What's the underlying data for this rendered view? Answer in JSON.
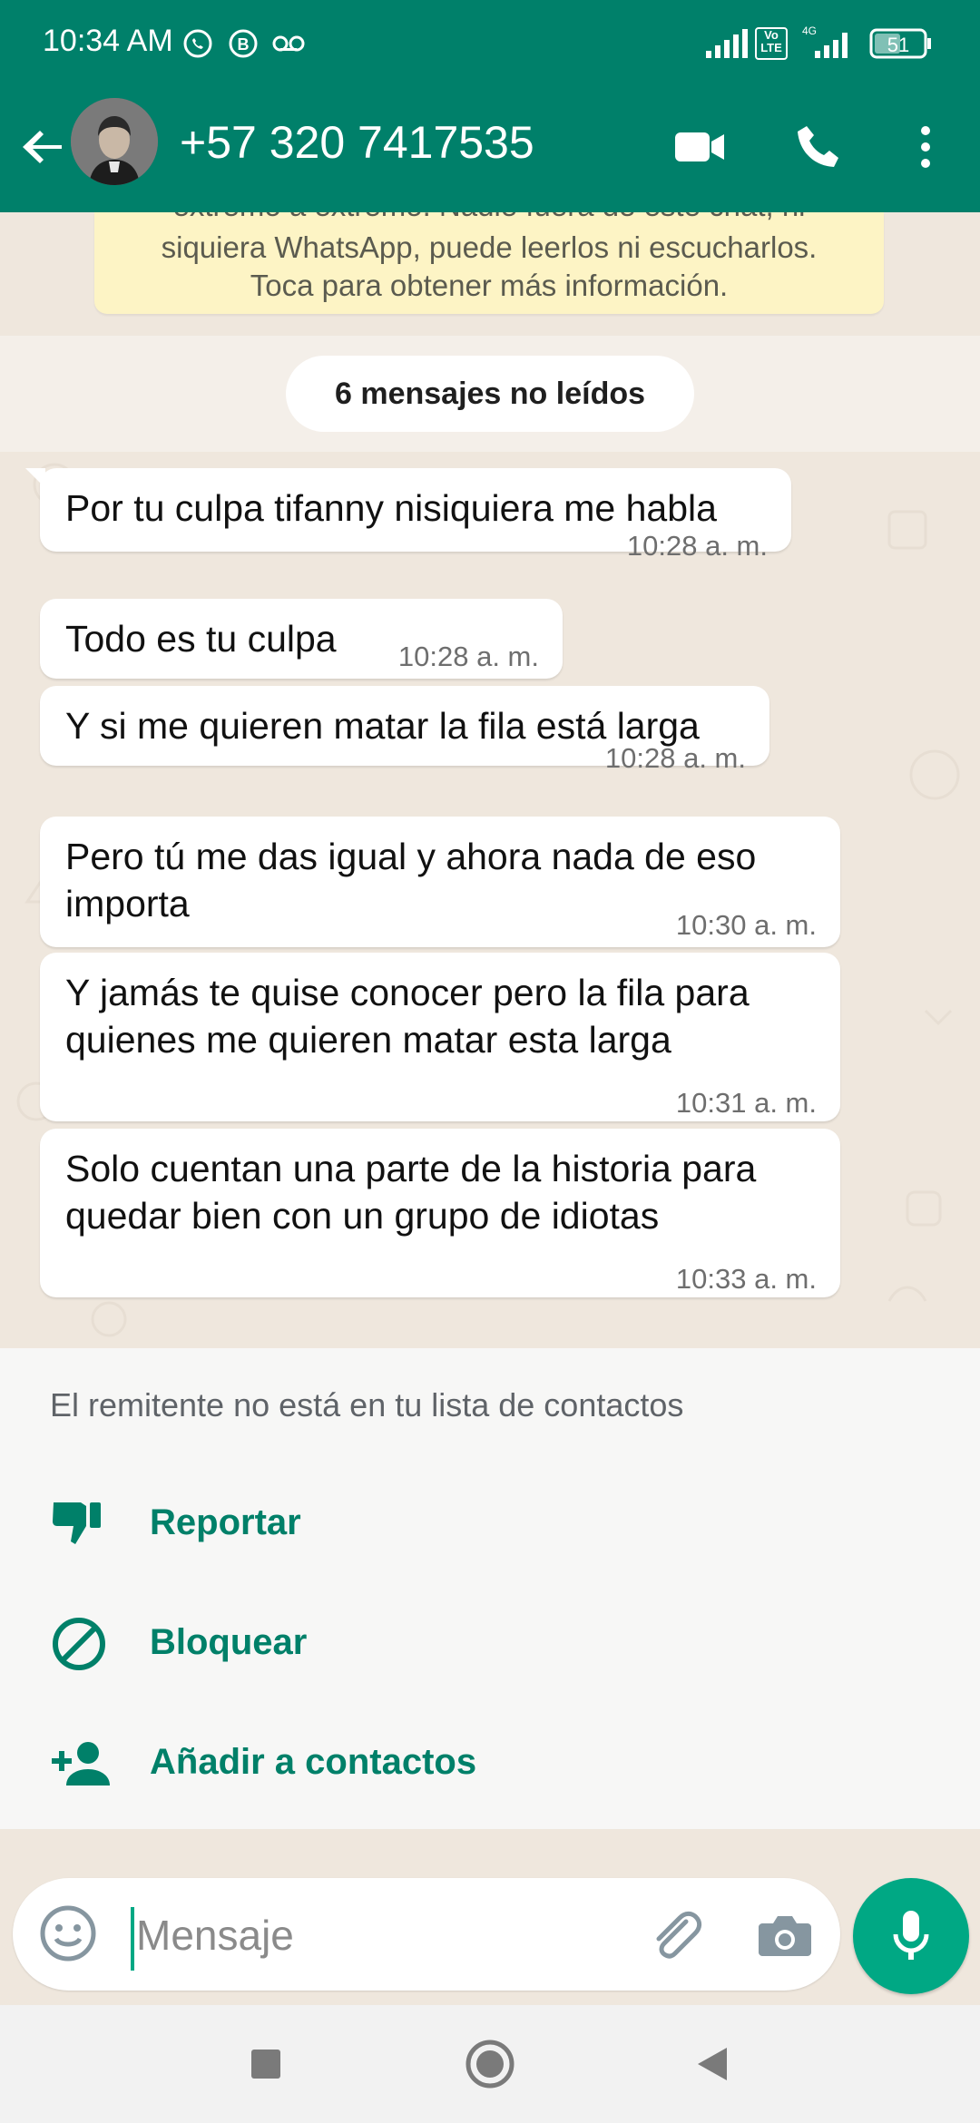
{
  "status_bar": {
    "time": "10:34 AM",
    "icons": [
      "whatsapp-notification-icon",
      "b-icon",
      "voicemail-icon",
      "signal-icon",
      "volte-icon",
      "4g-signal-icon",
      "battery-icon"
    ],
    "network": "4G",
    "volte": "Vo LTE",
    "battery": "51"
  },
  "app_bar": {
    "contact_name": "+57 320 7417535",
    "icons": [
      "back-arrow-icon",
      "avatar",
      "video-call-icon",
      "voice-call-icon",
      "more-vert-icon"
    ]
  },
  "encryption_notice": {
    "line1": "extremo a extremo. Nadie fuera de este chat, ni",
    "line2": "siquiera WhatsApp, puede leerlos ni escucharlos.",
    "line3": "Toca para obtener más información."
  },
  "unread_label": "6 mensajes no leídos",
  "messages": [
    {
      "text": "Por tu culpa tifanny nisiquiera me habla",
      "time": "10:28 a. m."
    },
    {
      "text": "Todo es tu culpa",
      "time": "10:28 a. m."
    },
    {
      "text": "Y si me quieren matar la fila está larga",
      "time": "10:28 a. m."
    },
    {
      "line1": "Pero tú me das igual y ahora nada de eso",
      "line2": "importa",
      "time": "10:30 a. m."
    },
    {
      "line1": "Y jamás te quise conocer pero la fila para",
      "line2": "quienes me quieren matar esta larga",
      "time": "10:31 a. m."
    },
    {
      "line1": "Solo cuentan una parte de la historia para",
      "line2": "quedar bien con un grupo de idiotas",
      "time": "10:33 a. m."
    }
  ],
  "unknown_sender_sheet": {
    "title": "El remitente no está en tu lista de contactos",
    "actions": [
      {
        "label": "Reportar",
        "icon": "thumbs-down-icon"
      },
      {
        "label": "Bloquear",
        "icon": "block-icon"
      },
      {
        "label": "Añadir a contactos",
        "icon": "add-person-icon"
      }
    ]
  },
  "composer": {
    "placeholder": "Mensaje",
    "icons": [
      "emoji-icon",
      "attach-icon",
      "camera-icon",
      "mic-icon"
    ]
  },
  "nav_bar": {
    "icons": [
      "recents-square-icon",
      "home-circle-icon",
      "back-triangle-icon"
    ]
  },
  "colors": {
    "header": "#00806a",
    "accent": "#00a884",
    "action_text": "#008069",
    "chat_bg": "#efe7dd",
    "banner": "#fdf4c5"
  }
}
